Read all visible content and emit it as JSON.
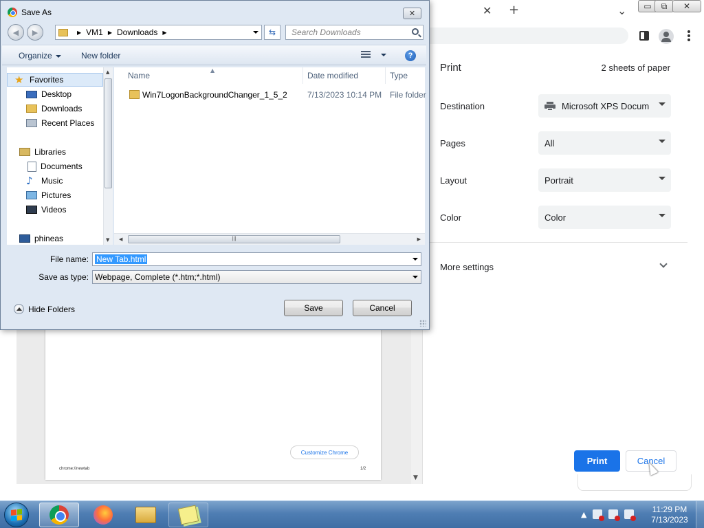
{
  "chrome": {
    "caption_buttons": [
      "▭",
      "⧉",
      "✕"
    ],
    "tab_close_glyph": "✕",
    "new_tab_glyph": "+",
    "tab_search_glyph": "⌄"
  },
  "preview": {
    "customize_label": "Customize Chrome",
    "footer_url": "chrome://newtab",
    "footer_page": "1/2"
  },
  "print_panel": {
    "title": "Print",
    "sheets": "2 sheets of paper",
    "destination": {
      "label": "Destination",
      "value": "Microsoft XPS Docum"
    },
    "pages": {
      "label": "Pages",
      "value": "All"
    },
    "layout": {
      "label": "Layout",
      "value": "Portrait"
    },
    "color": {
      "label": "Color",
      "value": "Color"
    },
    "more_settings": "More settings",
    "print_button": "Print",
    "cancel_button": "Cancel",
    "accent_color": "#1a73e8"
  },
  "dialog": {
    "title": "Save As",
    "close_glyph": "✕",
    "breadcrumb": [
      "VM1",
      "Downloads"
    ],
    "search_placeholder": "Search Downloads",
    "toolbar": {
      "organize": "Organize",
      "new_folder": "New folder"
    },
    "nav": {
      "favorites": "Favorites",
      "desktop": "Desktop",
      "downloads": "Downloads",
      "recent_places": "Recent Places",
      "libraries": "Libraries",
      "documents": "Documents",
      "music": "Music",
      "pictures": "Pictures",
      "videos": "Videos",
      "computer": "phineas"
    },
    "columns": {
      "name": "Name",
      "date_modified": "Date modified",
      "type": "Type"
    },
    "files": [
      {
        "name": "Win7LogonBackgroundChanger_1_5_2",
        "date": "7/13/2023 10:14 PM",
        "type": "File folder"
      }
    ],
    "file_name": {
      "label": "File name:",
      "value": "New Tab.html"
    },
    "save_as_type": {
      "label": "Save as type:",
      "value": "Webpage, Complete (*.htm;*.html)"
    },
    "hide_folders": "Hide Folders",
    "save_button": "Save",
    "cancel_button": "Cancel"
  },
  "taskbar": {
    "time": "11:29 PM",
    "date": "7/13/2023",
    "tray_overflow_glyph": "▲"
  }
}
